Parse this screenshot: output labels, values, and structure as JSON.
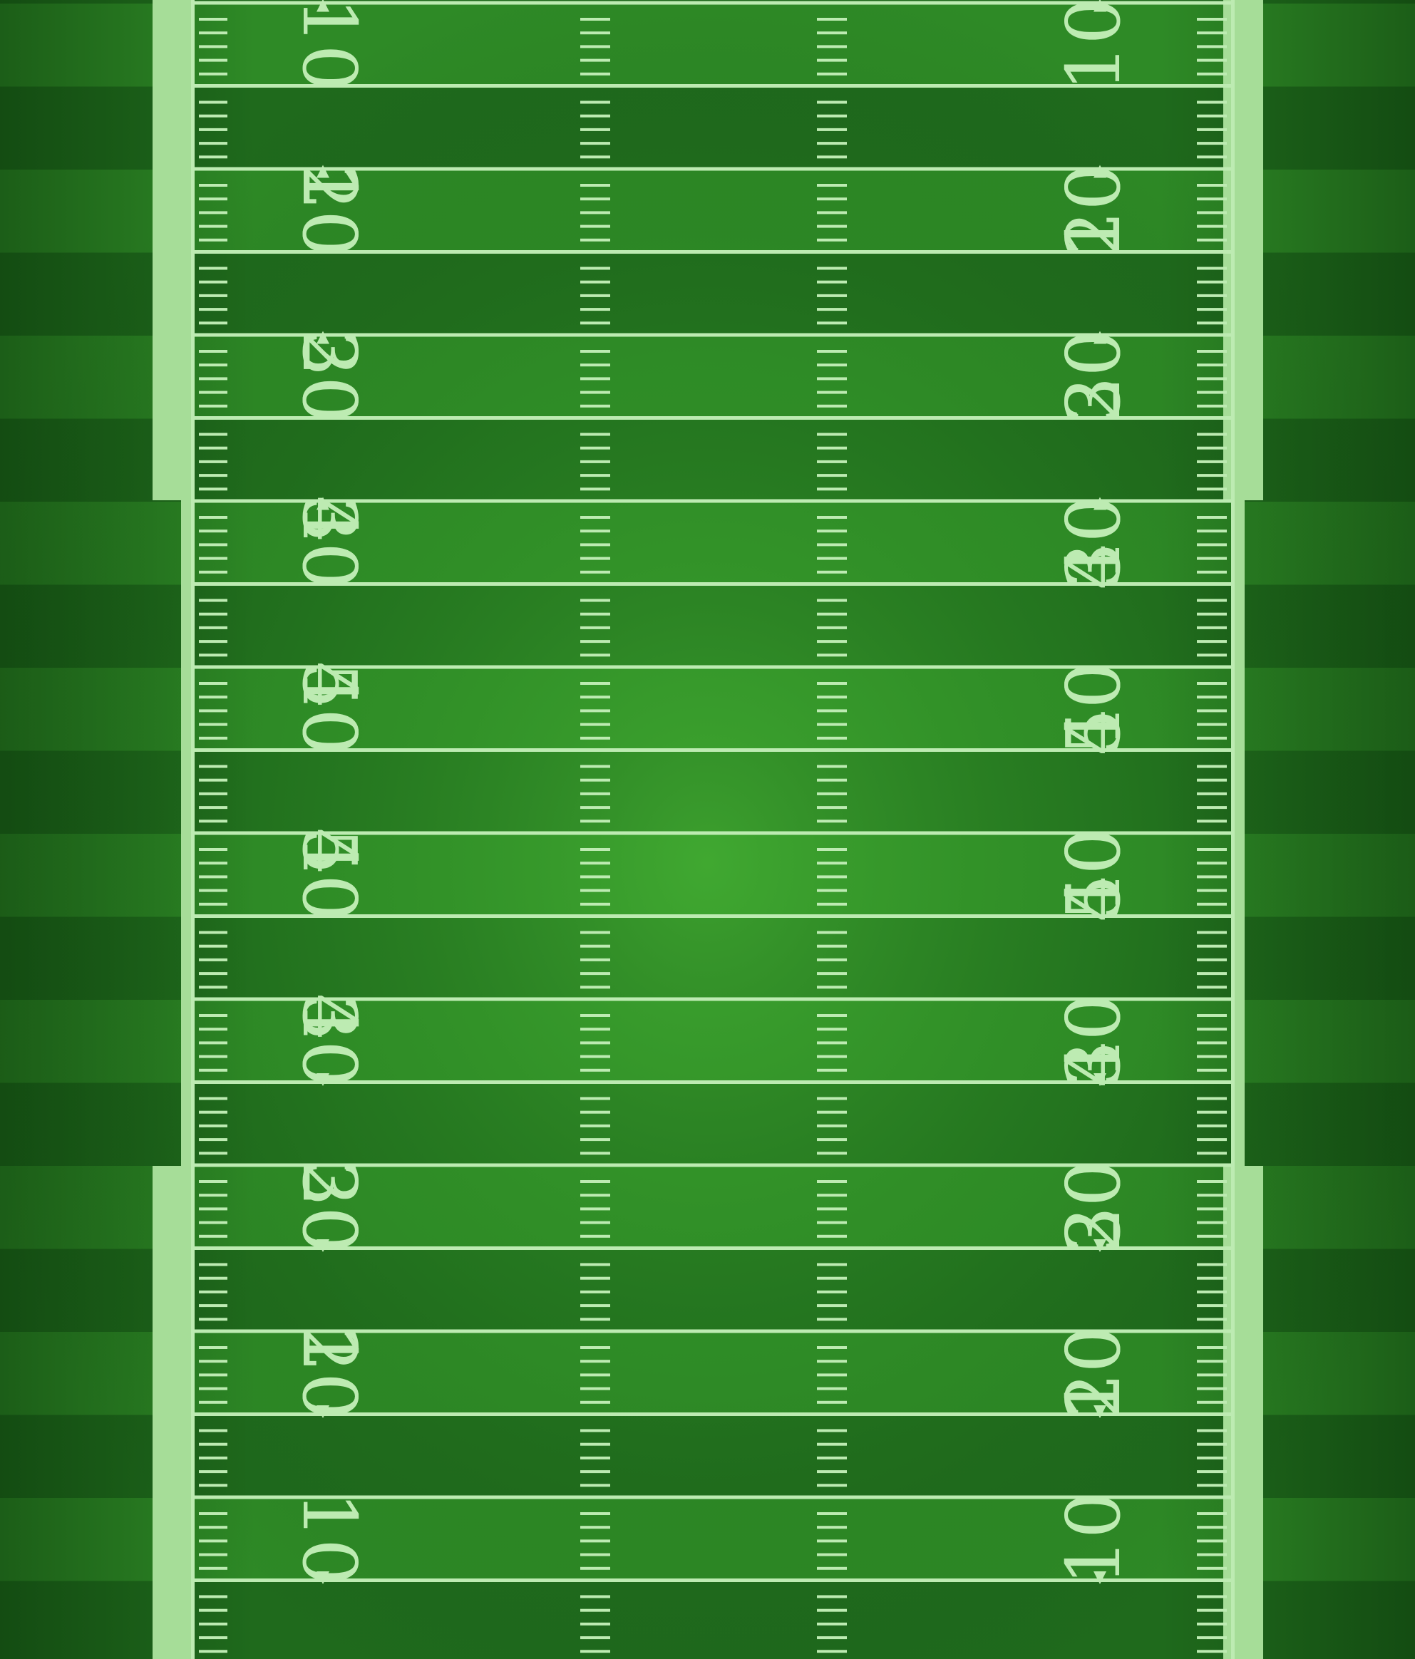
{
  "field": {
    "type": "american-football-field",
    "view": "top-down",
    "orientation": "vertical",
    "colors": {
      "grass_dark": "#1f6a1c",
      "grass_light": "#2e8a26",
      "grass_center": "#3da52f",
      "line": "#bdebb2",
      "sideline_band": "#a6dd98"
    },
    "yard_numbers_left": [
      "10",
      "10",
      "20",
      "20",
      "30",
      "30",
      "40",
      "40",
      "50",
      "50",
      "40",
      "40",
      "30",
      "30",
      "20",
      "20",
      "10",
      "10"
    ],
    "yard_numbers_right": [
      "10",
      "10",
      "20",
      "20",
      "30",
      "30",
      "40",
      "40",
      "50",
      "50",
      "40",
      "40",
      "30",
      "30",
      "20",
      "20",
      "10",
      "10"
    ]
  }
}
